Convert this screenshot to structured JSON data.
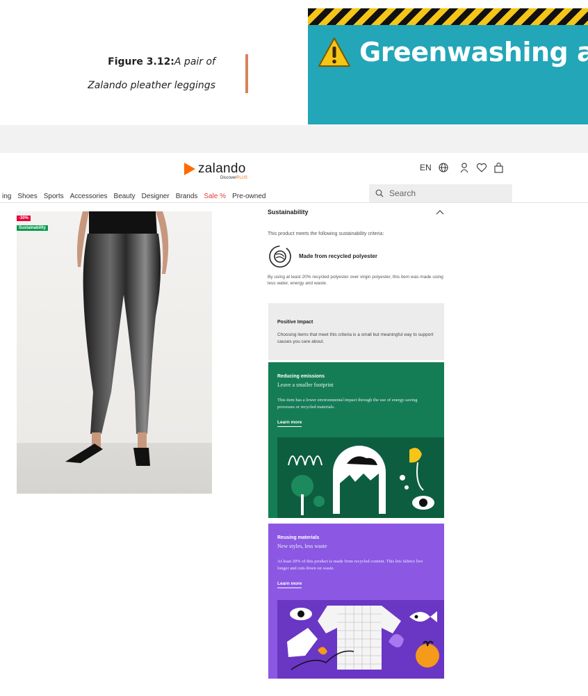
{
  "caption": {
    "label": "Figure 3.12:",
    "text_line1": "A pair of",
    "text_line2": "Zalando pleather leggings"
  },
  "alert": {
    "title": "Greenwashing ale",
    "icon": "warning-triangle-icon"
  },
  "colors": {
    "banner": "#22a6b8",
    "accent_rule": "#d9825a",
    "brand": "#ff6900",
    "sale": "#e23a3a",
    "green_card": "#157d56",
    "purple_card": "#8b57e3"
  },
  "header": {
    "logo": "zalando",
    "logo_sub_prefix": "Discover",
    "logo_sub_suffix": "PLUS",
    "language": "EN",
    "icons": [
      "globe-icon",
      "account-icon",
      "wishlist-heart-icon",
      "bag-icon"
    ]
  },
  "nav": {
    "items": [
      {
        "label": "ing"
      },
      {
        "label": "Shoes"
      },
      {
        "label": "Sports"
      },
      {
        "label": "Accessories"
      },
      {
        "label": "Beauty"
      },
      {
        "label": "Designer"
      },
      {
        "label": "Brands"
      },
      {
        "label": "Sale %"
      },
      {
        "label": "Pre-owned"
      }
    ],
    "search_placeholder": "Search"
  },
  "product": {
    "badges": {
      "discount": "-30%",
      "sustainability": "Sustainability"
    }
  },
  "sustainability": {
    "heading": "Sustainability",
    "intro": "This product meets the following sustainability criteria:",
    "criterion": "Made from recycled polyester",
    "description": "By using at least 20% recycled polyester over virgin polyester, this item was made using less water, energy and waste."
  },
  "cards": {
    "positive": {
      "title": "Positive Impact",
      "body": "Choosing items that meet this criteria is a small but meaningful way to support causes you care about."
    },
    "emissions": {
      "title": "Reducing emissions",
      "subtitle": "Leave a smaller footprint",
      "body": "This item has a lower environmental impact through the use of energy-saving processes or recycled materials.",
      "link": "Learn more"
    },
    "materials": {
      "title": "Reusing materials",
      "subtitle": "New styles, less waste",
      "body": "At least 20% of this product is made from recycled content. This lets fabrics live longer and cuts down on waste.",
      "link": "Learn more"
    }
  }
}
